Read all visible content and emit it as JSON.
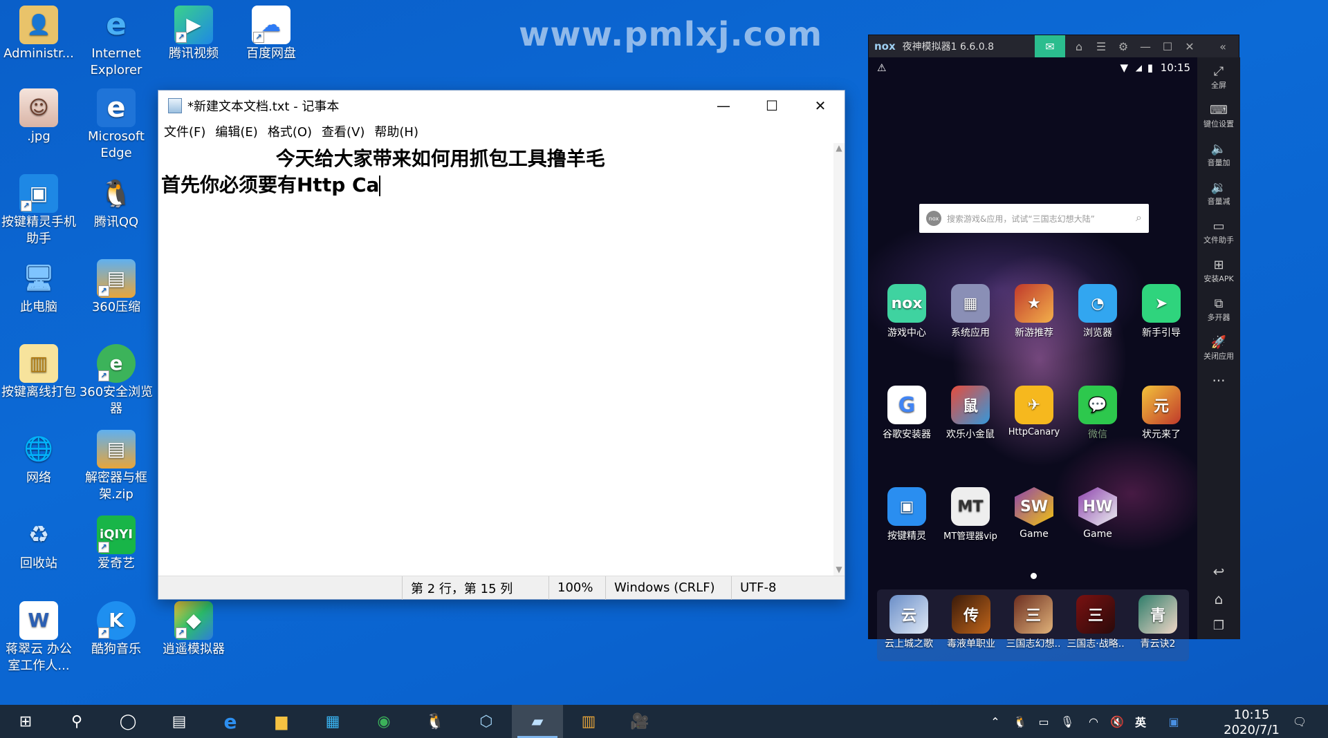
{
  "watermark": "www.pmlxj.com",
  "desktop_icons": [
    {
      "label": "Administr...",
      "icon": "user-folder-icon"
    },
    {
      "label": "Internet Explorer",
      "icon": "internet-explorer-icon"
    },
    {
      "label": "腾讯视频",
      "icon": "tencent-video-icon"
    },
    {
      "label": "百度网盘",
      "icon": "baidu-netdisk-icon"
    },
    {
      "label": ".jpg",
      "icon": "photo-icon"
    },
    {
      "label": "Microsoft Edge",
      "icon": "edge-icon"
    },
    {
      "label": "按键精灵手机助手",
      "icon": "anjian-phone-icon"
    },
    {
      "label": "腾讯QQ",
      "icon": "qq-icon"
    },
    {
      "label": "此电脑",
      "icon": "this-pc-icon"
    },
    {
      "label": "360压缩",
      "icon": "360-zip-icon"
    },
    {
      "label": "按键离线打包",
      "icon": "anjian-package-icon"
    },
    {
      "label": "360安全浏览器",
      "icon": "360-browser-icon"
    },
    {
      "label": "网络",
      "icon": "network-icon"
    },
    {
      "label": "解密器与框架.zip",
      "icon": "zip-archive-icon"
    },
    {
      "label": "回收站",
      "icon": "recycle-bin-icon"
    },
    {
      "label": "爱奇艺",
      "icon": "iqiyi-icon"
    },
    {
      "label": "蒋翠云 办公室工作人...",
      "icon": "word-doc-icon"
    },
    {
      "label": "酷狗音乐",
      "icon": "kugou-icon"
    },
    {
      "label": "逍遥模拟器",
      "icon": "memu-emulator-icon"
    }
  ],
  "notepad": {
    "title": "*新建文本文档.txt - 记事本",
    "menu": [
      "文件(F)",
      "编辑(E)",
      "格式(O)",
      "查看(V)",
      "帮助(H)"
    ],
    "lines": [
      "                 今天给大家带来如何用抓包工具撸羊毛",
      "首先你必须要有Http Ca"
    ],
    "status": {
      "position": "第 2 行，第 15 列",
      "zoom": "100%",
      "line_ending": "Windows (CRLF)",
      "encoding": "UTF-8"
    }
  },
  "nox": {
    "title": "夜神模拟器1 6.6.0.8",
    "logo": "nox",
    "time": "10:15",
    "search_placeholder": "搜索游戏&应用，试试“三国志幻想大陆”",
    "apps_row1": [
      "游戏中心",
      "系统应用",
      "新游推荐",
      "浏览器",
      "新手引导"
    ],
    "apps_row2": [
      "谷歌安装器",
      "欢乐小金鼠",
      "HttpCanary",
      "微信",
      "状元来了"
    ],
    "apps_row3": [
      "按键精灵",
      "MT管理器vip",
      "Game",
      "Game"
    ],
    "dock": [
      "云上城之歌",
      "毒液单职业",
      "三国志幻想..",
      "三国志·战略..",
      "青云诀2"
    ],
    "sidebar": [
      "全屏",
      "键位设置",
      "音量加",
      "音量减",
      "文件助手",
      "安装APK",
      "多开器",
      "关闭应用"
    ]
  },
  "taskbar": {
    "time": "10:15",
    "date": "2020/7/1",
    "ime": "英"
  },
  "colors": {
    "desktop": "#0c6ad6",
    "taskbar": "#1b2a3b",
    "nox_accent": "#2bbd8e"
  }
}
